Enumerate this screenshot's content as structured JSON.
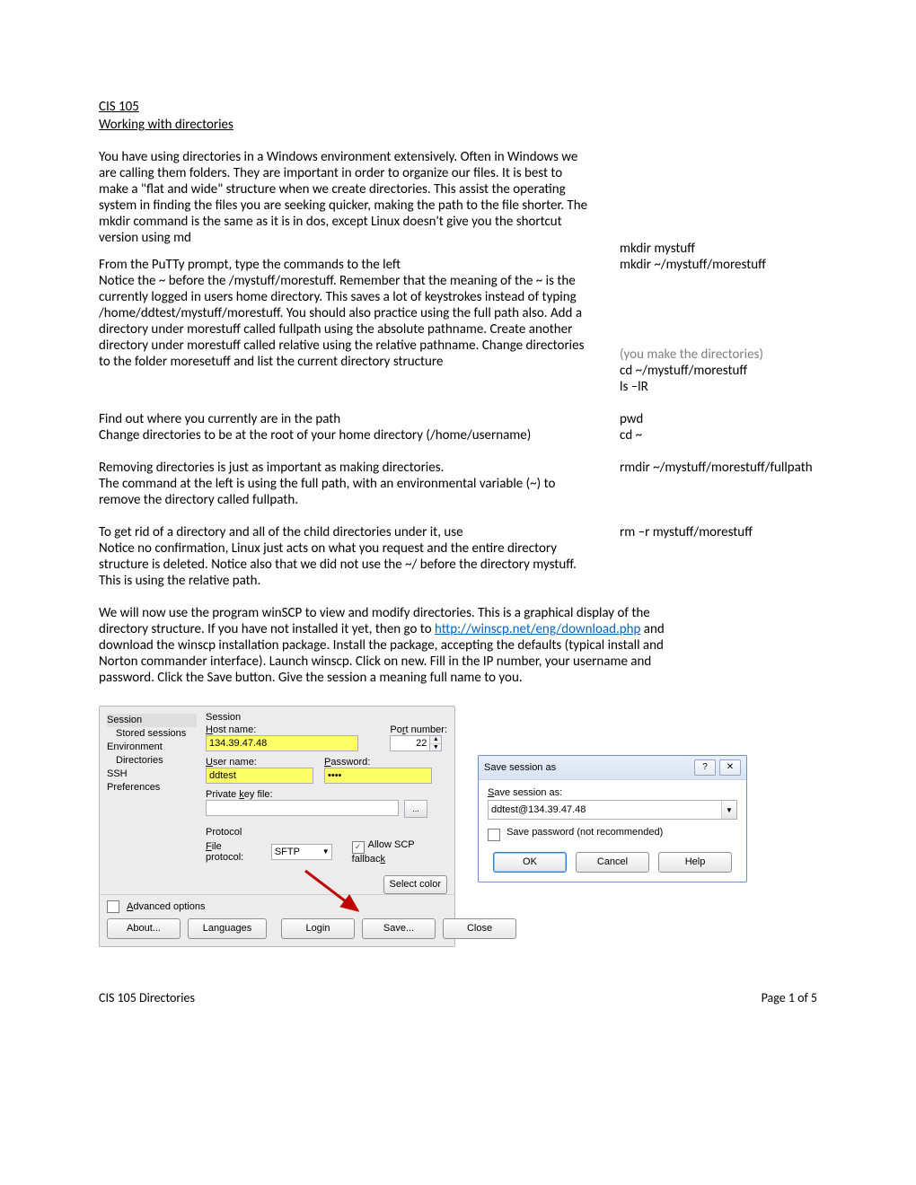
{
  "header": {
    "line1": "CIS 105",
    "line2": "Working with directories"
  },
  "blocks": {
    "intro": "You have using directories in a Windows environment extensively.  Often in Windows we are calling them folders. They are important in order to organize our files.  It is best to make a \"flat and wide\" structure when we create directories.  This assist the operating system in finding the files you are seeking quicker, making the path to the file shorter.   The mkdir command is the same as it is in dos, except Linux doesn't give you the shortcut version using md",
    "putyLine": "From the PuTTy prompt, type the commands to the left",
    "noticeBlock": "Notice the ~ before the /mystuff/morestuff.  Remember that the meaning of the ~ is the currently logged in users home directory.  This saves a lot of keystrokes instead of typing  /home/ddtest/mystuff/morestuff.  You should also practice using the full path also.  Add a directory under morestuff called fullpath using the absolute pathname.   Create another directory under morestuff called relative using the relative pathname.  Change directories to the folder  moresetuff and list the current directory structure",
    "findLine": "Find out where you currently are in the path",
    "cdHomeLine": "Change directories to be at the root of your home directory (/home/username)",
    "rmdirBlock": "Removing directories is just as important as making directories.",
    "rmdirCont": "The command at the left is using the full path, with an environmental variable (~) to remove the directory called fullpath.",
    "rmBlock": "To get rid of a directory and all of the child directories under it, use",
    "rmCont": "Notice no confirmation, Linux just acts on what you request and the entire directory structure is deleted.  Notice also that we did not use the ~/ before the directory mystuff.  This is using the relative path.",
    "winscpPre": "We will now use the program winSCP to view and modify directories.  This is a graphical display of the directory structure.  If you have not installed it yet, then go to ",
    "winscpLinkText": "http://winscp.net/eng/download.php",
    "winscpPost": " and download the winscp installation package.  Install the package, accepting the defaults (typical install and Norton commander interface).  Launch winscp.  Click on new. Fill in the IP number, your username and password.  Click the Save button.  Give the session a meaning full name to you."
  },
  "cmds": {
    "mkdir1": "mkdir mystuff",
    "mkdir2": "mkdir ~/mystuff/morestuff",
    "youmake": "(you make the directories)",
    "cdmore": "cd ~/mystuff/morestuff",
    "lsr": "ls –lR",
    "pwd": "pwd",
    "cdhome": "cd ~",
    "rmdir": "rmdir ~/mystuff/morestuff/fullpath",
    "rmr": "rm  –r mystuff/morestuff"
  },
  "login": {
    "tree": {
      "session": "Session",
      "stored": "Stored sessions",
      "env": "Environment",
      "dirs": "Directories",
      "ssh": "SSH",
      "prefs": "Preferences"
    },
    "labels": {
      "session": "Session",
      "host": "Host name:",
      "port": "Port number:",
      "user": "User name:",
      "pass": "Password:",
      "pkf": "Private key file:",
      "protocol": "Protocol",
      "fileproto": "File protocol:",
      "scp": "Allow SCP fallback",
      "selcolor": "Select color",
      "adv": "Advanced options",
      "about": "About...",
      "lang": "Languages",
      "login": "Login",
      "save": "Save...",
      "close": "Close"
    },
    "values": {
      "host": "134.39.47.48",
      "port": "22",
      "user": "ddtest",
      "pass": "••••",
      "proto": "SFTP"
    }
  },
  "ssd": {
    "title": "Save session as",
    "label": "Save session as:",
    "value": "ddtest@134.39.47.48",
    "savepw": "Save password (not recommended)",
    "ok": "OK",
    "cancel": "Cancel",
    "help": "Help"
  },
  "footer": {
    "left": "CIS 105 Directories",
    "right": "Page 1 of 5"
  }
}
